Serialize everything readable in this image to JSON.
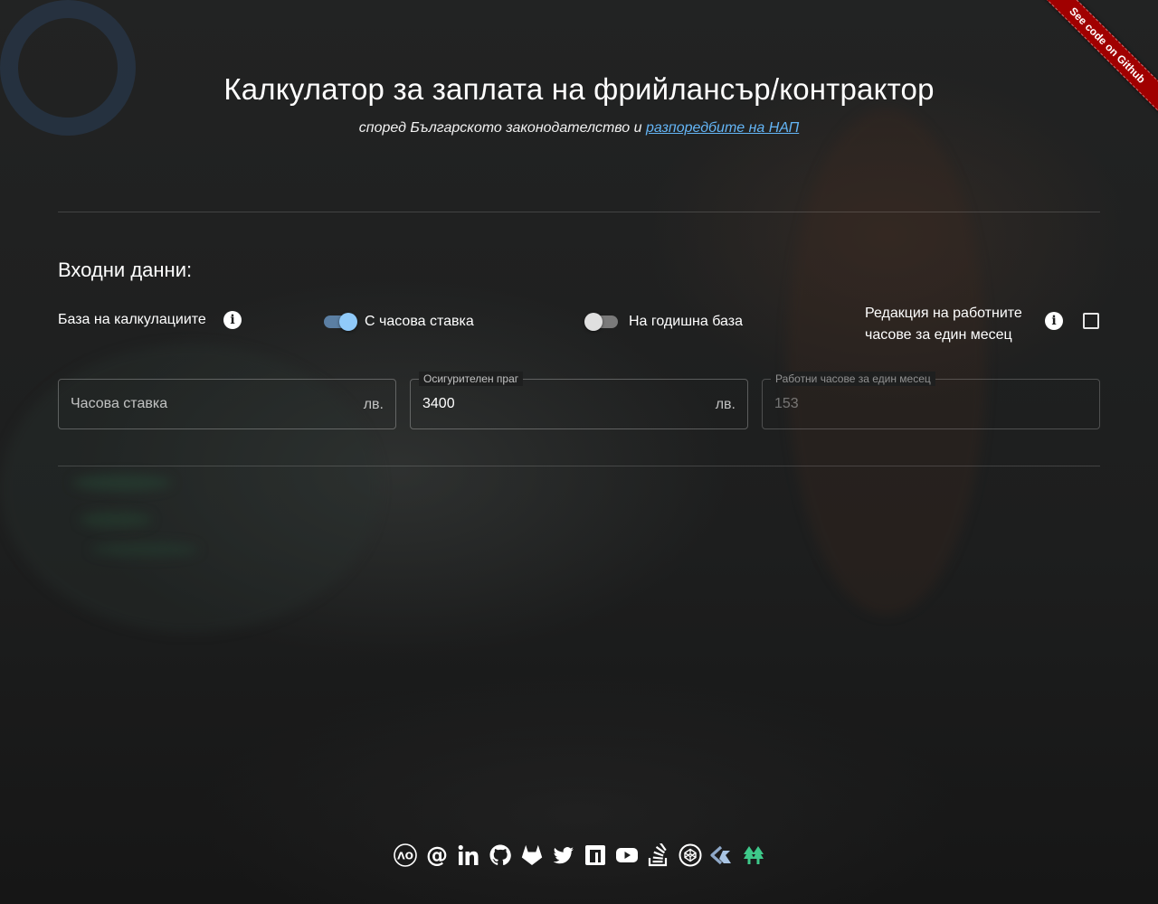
{
  "header": {
    "title": "Калкулатор за заплата на фрийлансър/контрактор",
    "subtitle_text": "според Българското законодателство и ",
    "subtitle_link": "разпоредбите на НАП",
    "ribbon": "See code on Github"
  },
  "inputs": {
    "section_title": "Входни данни:",
    "basis_label": "База на калкулациите",
    "info_icon": "info-icon",
    "toggle_hourly": {
      "label": "С часова ставка",
      "checked": true
    },
    "toggle_annual": {
      "label": "На годишна база",
      "checked": false
    },
    "edit_hours_label_line1": "Редакция на работните",
    "edit_hours_label_line2": "часове за един месец",
    "edit_hours_checked": false,
    "hourly_rate": {
      "placeholder": "Часова ставка",
      "value": "",
      "suffix": "лв."
    },
    "insurance_threshold": {
      "label": "Осигурителен праг",
      "value": "3400",
      "suffix": "лв."
    },
    "monthly_hours": {
      "label": "Работни часове за един месец",
      "value": "153",
      "disabled": true
    }
  },
  "footer": {
    "social_icons": [
      "a0-icon",
      "at-icon",
      "linkedin-icon",
      "github-icon",
      "gitlab-icon",
      "twitter-icon",
      "npm-icon",
      "youtube-icon",
      "stackoverflow-icon",
      "codepen-icon",
      "codeship-icon",
      "pine-tree-icon"
    ]
  },
  "colors": {
    "background": "#1c1d1d",
    "accent": "#90caf9",
    "link": "#64b5f6",
    "ribbon": "#a00000"
  }
}
